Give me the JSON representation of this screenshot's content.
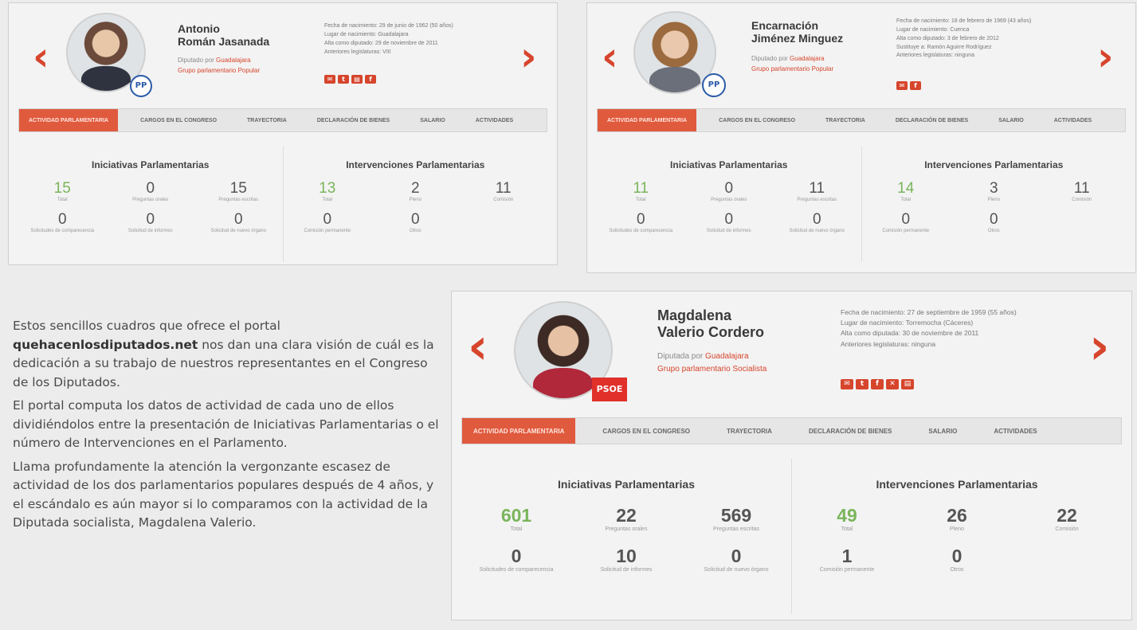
{
  "accent_color": "#d6452c",
  "stat_highlight_color": "#7ab55c",
  "tabs": [
    "ACTIVIDAD PARLAMENTARIA",
    "CARGOS EN EL CONGRESO",
    "TRAYECTORIA",
    "DECLARACIÓN DE BIENES",
    "SALARIO",
    "ACTIVIDADES"
  ],
  "panel_titles": {
    "initiatives": "Iniciativas Parlamentarias",
    "interventions": "Intervenciones Parlamentarias"
  },
  "nav": {
    "prev": "‹",
    "next": "›"
  },
  "deputies": [
    {
      "name_line1": "Antonio",
      "name_line2": "Román Jasanada",
      "district_label": "Diputado por",
      "district": "Guadalajara",
      "group": "Grupo parlamentario Popular",
      "party_badge": "PP",
      "social_icons": [
        "mail-icon",
        "twitter-icon",
        "blog-icon",
        "facebook-icon"
      ],
      "details": {
        "birth": "Fecha de nacimiento: 29 de junio de 1962 (50 años)",
        "birthplace": "Lugar de nacimiento: Guadalajara",
        "since": "Alta como diputado: 29 de noviembre de 2011",
        "legislatures": "Anteriores legislaturas: VIII"
      },
      "initiatives": [
        {
          "value": "15",
          "label": "Total"
        },
        {
          "value": "0",
          "label": "Preguntas orales"
        },
        {
          "value": "15",
          "label": "Preguntas escritas"
        },
        {
          "value": "0",
          "label": "Solicitudes de comparecencia"
        },
        {
          "value": "0",
          "label": "Solicitud de informes"
        },
        {
          "value": "0",
          "label": "Solicitud de nuevo órgano"
        }
      ],
      "interventions": [
        {
          "value": "13",
          "label": "Total"
        },
        {
          "value": "2",
          "label": "Pleno"
        },
        {
          "value": "11",
          "label": "Comisión"
        },
        {
          "value": "0",
          "label": "Comisión permanente"
        },
        {
          "value": "0",
          "label": "Otros"
        }
      ]
    },
    {
      "name_line1": "Encarnación",
      "name_line2": "Jiménez Minguez",
      "district_label": "Diputado por",
      "district": "Guadalajara",
      "group": "Grupo parlamentario Popular",
      "party_badge": "PP",
      "social_icons": [
        "mail-icon",
        "facebook-icon"
      ],
      "details": {
        "birth": "Fecha de nacimiento: 18 de febrero de 1969 (43 años)",
        "birthplace": "Lugar de nacimiento: Cuenca",
        "since": "Alta como diputado: 3 de febrero de 2012",
        "substitute": "Sustituye a: Ramón Aguirre Rodríguez",
        "legislatures": "Anteriores legislaturas: ninguna"
      },
      "initiatives": [
        {
          "value": "11",
          "label": "Total"
        },
        {
          "value": "0",
          "label": "Preguntas orales"
        },
        {
          "value": "11",
          "label": "Preguntas escritas"
        },
        {
          "value": "0",
          "label": "Solicitudes de comparecencia"
        },
        {
          "value": "0",
          "label": "Solicitud de informes"
        },
        {
          "value": "0",
          "label": "Solicitud de nuevo órgano"
        }
      ],
      "interventions": [
        {
          "value": "14",
          "label": "Total"
        },
        {
          "value": "3",
          "label": "Pleno"
        },
        {
          "value": "11",
          "label": "Comisión"
        },
        {
          "value": "0",
          "label": "Comisión permanente"
        },
        {
          "value": "0",
          "label": "Otros"
        }
      ]
    },
    {
      "name_line1": "Magdalena",
      "name_line2": "Valerio Cordero",
      "district_label": "Diputada por",
      "district": "Guadalajara",
      "group": "Grupo parlamentario Socialista",
      "party_badge": "PSOE",
      "social_icons": [
        "mail-icon",
        "twitter-icon",
        "facebook-icon",
        "x-icon",
        "blog-icon"
      ],
      "details": {
        "birth": "Fecha de nacimiento: 27 de septiembre de 1959 (55 años)",
        "birthplace": "Lugar de nacimiento: Torremocha (Cáceres)",
        "since": "Alta como diputada: 30 de noviembre de 2011",
        "legislatures": "Anteriores legislaturas: ninguna"
      },
      "initiatives": [
        {
          "value": "601",
          "label": "Total"
        },
        {
          "value": "22",
          "label": "Preguntas orales"
        },
        {
          "value": "569",
          "label": "Preguntas escritas"
        },
        {
          "value": "0",
          "label": "Solicitudes de comparecencia"
        },
        {
          "value": "10",
          "label": "Solicitud de informes"
        },
        {
          "value": "0",
          "label": "Solicitud de nuevo órgano"
        }
      ],
      "interventions": [
        {
          "value": "49",
          "label": "Total"
        },
        {
          "value": "26",
          "label": "Pleno"
        },
        {
          "value": "22",
          "label": "Comisión"
        },
        {
          "value": "1",
          "label": "Comisión permanente"
        },
        {
          "value": "0",
          "label": "Otros"
        }
      ]
    }
  ],
  "article": {
    "p1_before": "Estos sencillos cuadros que ofrece el portal ",
    "p1_bold": "quehacenlosdiputados.net",
    "p1_after": " nos dan una clara visión de cuál es la dedicación a su trabajo de nuestros representantes en el Congreso de los Diputados.",
    "p2": "El portal computa los datos de actividad de cada uno de ellos dividiéndolos entre la presentación de Iniciativas Parlamentarias o el número de Intervenciones en el Parlamento.",
    "p3": "Llama profundamente la atención la vergonzante escasez de actividad de los dos parlamentarios populares después de 4 años, y el escándalo es aún mayor si lo comparamos con la actividad de la Diputada socialista, Magdalena Valerio."
  }
}
